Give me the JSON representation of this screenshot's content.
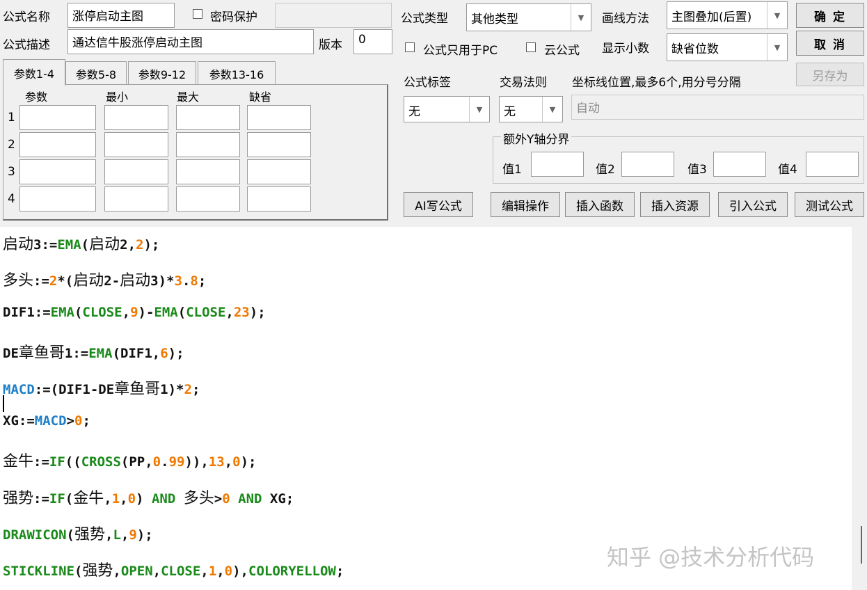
{
  "form": {
    "name_label": "公式名称",
    "name_value": "涨停启动主图",
    "password_label": "密码保护",
    "desc_label": "公式描述",
    "desc_value": "通达信牛股涨停启动主图",
    "version_label": "版本",
    "version_value": "0",
    "type_label": "公式类型",
    "type_value": "其他类型",
    "draw_label": "画线方法",
    "draw_value": "主图叠加(后置)",
    "pc_only_label": "公式只用于PC",
    "cloud_label": "云公式",
    "decimals_label": "显示小数",
    "decimals_value": "缺省位数",
    "tag_label": "公式标签",
    "tag_value": "无",
    "rule_label": "交易法则",
    "rule_value": "无",
    "coord_label": "坐标线位置,最多6个,用分号分隔",
    "coord_value": "自动",
    "yaxis_group_label": "额外Y轴分界",
    "y_values": [
      "值1",
      "值2",
      "值3",
      "值4"
    ]
  },
  "buttons": {
    "ok": "确  定",
    "cancel": "取  消",
    "save_as": "另存为",
    "ai": "AI写公式",
    "edit": "编辑操作",
    "insert_func": "插入函数",
    "insert_res": "插入资源",
    "import": "引入公式",
    "test": "测试公式"
  },
  "tabs": [
    "参数1-4",
    "参数5-8",
    "参数9-12",
    "参数13-16"
  ],
  "param_headers": [
    "参数",
    "最小",
    "最大",
    "缺省"
  ],
  "param_rows": [
    "1",
    "2",
    "3",
    "4"
  ],
  "code_lines": [
    "启动3:=EMA(启动2,2);",
    "多头:=2*(启动2-启动3)*3.8;",
    "DIF1:=EMA(CLOSE,9)-EMA(CLOSE,23);",
    "DE章鱼哥1:=EMA(DIF1,6);",
    "MACD:=(DIF1-DE章鱼哥1)*2;",
    "XG:=MACD>0;",
    "金牛:=IF((CROSS(PP,0.99)),13,0);",
    "强势:=IF(金牛,1,0) AND 多头>0 AND XG;",
    "DRAWICON(强势,L,9);",
    "STICKLINE(强势,OPEN,CLOSE,1,0),COLORYELLOW;"
  ],
  "watermark": "知乎 @技术分析代码",
  "colors": {
    "keyword": "#1a8a1a",
    "number": "#f07800",
    "variable": "#1f7fc8"
  }
}
